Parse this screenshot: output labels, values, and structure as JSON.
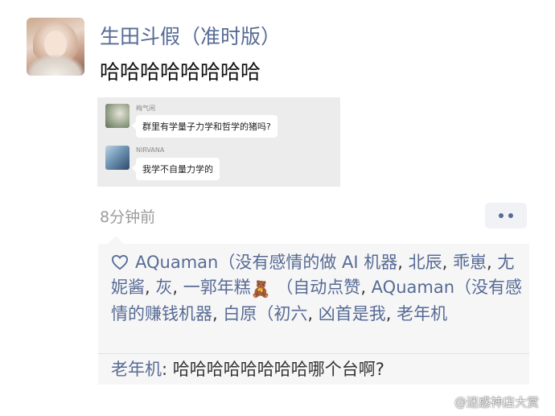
{
  "post": {
    "nickname": "生田斗假（准时版）",
    "text": "哈哈哈哈哈哈哈哈",
    "timestamp": "8分钟前"
  },
  "shared_image": {
    "messages": [
      {
        "sender": "梅气闲",
        "text": "群里有学量子力学和哲学的猪吗?"
      },
      {
        "sender": "NIRVANA",
        "text": "我学不自量力学的"
      }
    ]
  },
  "likes": {
    "icon": "heart-outline-icon",
    "segments": [
      {
        "text": "AQuaman（没有感情的做 AI 机器",
        "kind": "name"
      },
      {
        "text": ", ",
        "kind": "sep"
      },
      {
        "text": "北辰",
        "kind": "name"
      },
      {
        "text": ", ",
        "kind": "sep"
      },
      {
        "text": "乖崽",
        "kind": "name"
      },
      {
        "text": ", ",
        "kind": "sep"
      },
      {
        "text": "尢妮酱",
        "kind": "name"
      },
      {
        "text": ", ",
        "kind": "sep"
      },
      {
        "text": "灰",
        "kind": "name"
      },
      {
        "text": ", ",
        "kind": "sep"
      },
      {
        "text": "一郭年糕",
        "kind": "name",
        "emoji": "🧸"
      },
      {
        "text": " ",
        "kind": "sep"
      },
      {
        "text": "（自动点赞",
        "kind": "name"
      },
      {
        "text": ", ",
        "kind": "sep"
      },
      {
        "text": "AQuaman（没有感情的赚钱机器",
        "kind": "name"
      },
      {
        "text": ", ",
        "kind": "sep"
      },
      {
        "text": "白原（初六",
        "kind": "name"
      },
      {
        "text": ", ",
        "kind": "sep"
      },
      {
        "text": "凶首是我",
        "kind": "name"
      },
      {
        "text": ", ",
        "kind": "sep"
      },
      {
        "text": "老年机",
        "kind": "name"
      }
    ]
  },
  "comments": [
    {
      "author": "老年机",
      "separator": ": ",
      "text": "哈哈哈哈哈哈哈哈哪个台啊?"
    }
  ],
  "watermark": {
    "text": "@迷惑神店大赏",
    "icon": "weibo-icon"
  },
  "colors": {
    "link": "#576b95",
    "timestamp": "#9b9b9b",
    "panel_bg": "#f6f6f6",
    "more_button_bg": "#f1f2f6"
  }
}
